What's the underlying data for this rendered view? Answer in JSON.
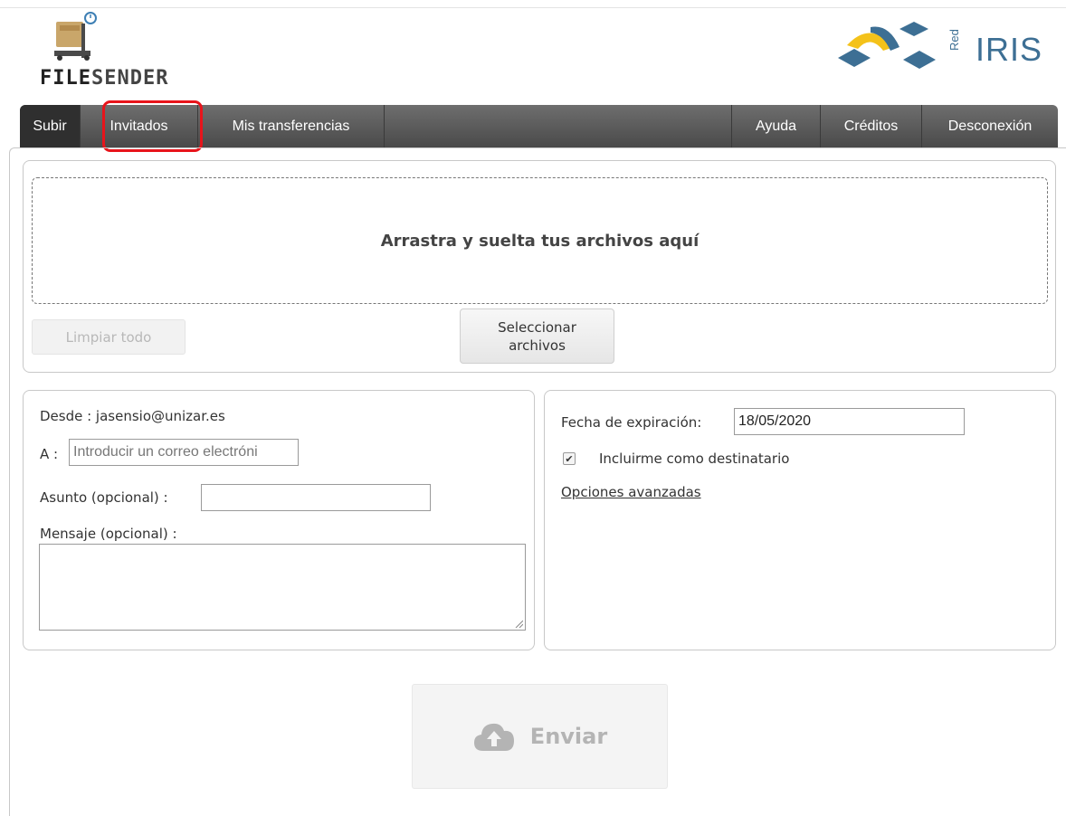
{
  "header": {
    "logo_text_bold": "FILE",
    "logo_text_rest": "SENDER",
    "partner_logo_text": "IRIS",
    "partner_logo_small": "Red"
  },
  "nav": {
    "items_left": [
      {
        "label": "Subir",
        "active": true
      },
      {
        "label": "Invitados",
        "active": false,
        "highlighted": true
      },
      {
        "label": "Mis transferencias",
        "active": false
      }
    ],
    "items_right": [
      {
        "label": "Ayuda"
      },
      {
        "label": "Créditos"
      },
      {
        "label": "Desconexión"
      }
    ]
  },
  "upload": {
    "dropzone_text": "Arrastra y suelta tus archivos aquí",
    "clear_button": "Limpiar todo",
    "select_button": "Seleccionar archivos"
  },
  "form": {
    "from_label": "Desde : jasensio@unizar.es",
    "to_label": "A :",
    "to_placeholder": "Introducir un correo electróni",
    "subject_label": "Asunto (opcional) :",
    "subject_value": "",
    "message_label": "Mensaje (opcional) :",
    "message_value": ""
  },
  "options": {
    "expiry_label": "Fecha de expiración:",
    "expiry_value": "18/05/2020",
    "include_me_label": "Incluirme como destinatario",
    "include_me_checked": true,
    "advanced_link": "Opciones avanzadas"
  },
  "send": {
    "label": "Enviar",
    "icon": "cloud-upload-icon"
  },
  "colors": {
    "nav_bg": "#5a5a5a",
    "nav_active": "#2f2f2f",
    "highlight": "#e8141b",
    "iris_blue": "#3d6f94",
    "iris_yellow": "#f4c21a"
  }
}
